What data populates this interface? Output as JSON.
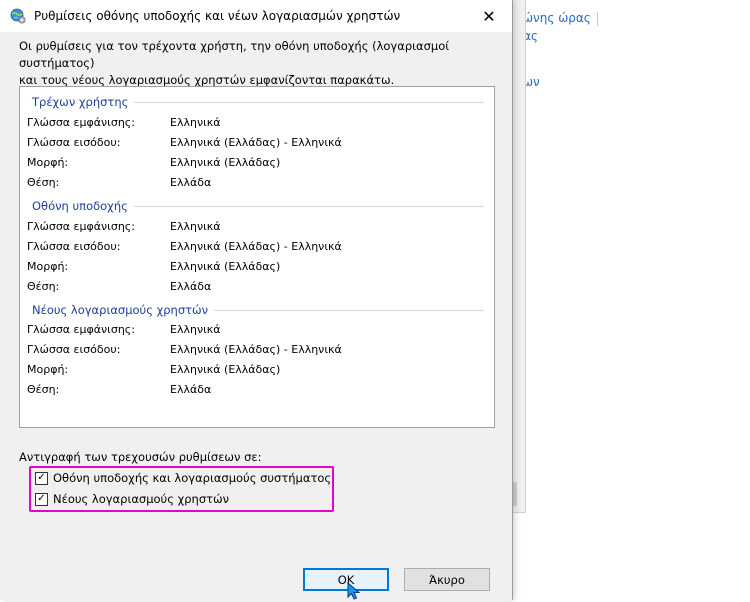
{
  "background": {
    "links": [
      "ώνης ώρας",
      "ας",
      "ων"
    ]
  },
  "dialog": {
    "title": "Ρυθμίσεις οθόνης υποδοχής και νέων λογαριασμών χρηστών",
    "title_icon": "globe-settings-icon",
    "close_label": "✕",
    "description": "Οι ρυθμίσεις για τον τρέχοντα χρήστη, την οθόνη υποδοχής (λογαριασμοί συστήματος)\nκαι τους νέους λογαριασμούς χρηστών εμφανίζονται παρακάτω.",
    "groups": [
      {
        "heading": "Τρέχων χρήστης",
        "rows": [
          {
            "label": "Γλώσσα εμφάνισης:",
            "value": "Ελληνικά"
          },
          {
            "label": "Γλώσσα εισόδου:",
            "value": "Ελληνικά (Ελλάδας) - Ελληνικά"
          },
          {
            "label": "Μορφή:",
            "value": "Ελληνικά (Ελλάδας)"
          },
          {
            "label": "Θέση:",
            "value": "Ελλάδα"
          }
        ]
      },
      {
        "heading": "Οθόνη υποδοχής",
        "rows": [
          {
            "label": "Γλώσσα εμφάνισης:",
            "value": "Ελληνικά"
          },
          {
            "label": "Γλώσσα εισόδου:",
            "value": "Ελληνικά (Ελλάδας) - Ελληνικά"
          },
          {
            "label": "Μορφή:",
            "value": "Ελληνικά (Ελλάδας)"
          },
          {
            "label": "Θέση:",
            "value": "Ελλάδα"
          }
        ]
      },
      {
        "heading": "Νέους λογαριασμούς χρηστών",
        "rows": [
          {
            "label": "Γλώσσα εμφάνισης:",
            "value": "Ελληνικά"
          },
          {
            "label": "Γλώσσα εισόδου:",
            "value": "Ελληνικά (Ελλάδας) - Ελληνικά"
          },
          {
            "label": "Μορφή:",
            "value": "Ελληνικά (Ελλάδας)"
          },
          {
            "label": "Θέση:",
            "value": "Ελλάδα"
          }
        ]
      }
    ],
    "copy_label": "Αντιγραφή των τρεχουσών ρυθμίσεων σε:",
    "checkboxes": [
      {
        "label": "Οθόνη υποδοχής και λογαριασμούς συστήματος",
        "checked": true
      },
      {
        "label": "Νέους λογαριασμούς χρηστών",
        "checked": true
      }
    ],
    "checkmark": "✓",
    "ok_label": "OK",
    "cancel_label": "Άκυρο",
    "highlight_color": "#e600c8",
    "accent_color": "#0078d7",
    "heading_color": "#1f3c9c"
  }
}
